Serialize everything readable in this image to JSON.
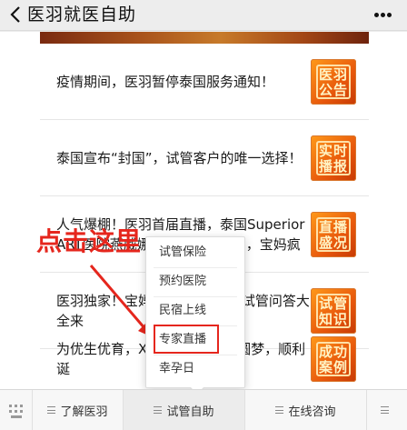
{
  "header": {
    "title": "医羽就医自助"
  },
  "articles": [
    {
      "title": "疫情期间，医羽暂停泰国服务通知！",
      "thumb": "医羽公告"
    },
    {
      "title": "泰国宣布“封国”，试管客户的唯一选择！",
      "thumb": "实时播报"
    },
    {
      "title": "人气爆棚！医羽首届直播，泰国Superior ART医院燕威娜医生降临直播间，宝妈疯狂...",
      "thumb": "直播盛况"
    },
    {
      "title": "医羽独家！宝妈 娜直播的24个试管问答大全来",
      "thumb": "试管知识"
    },
    {
      "title": "为优生优育，X 二移，32岁终圆梦，顺利诞",
      "thumb": "成功案例"
    }
  ],
  "popup": {
    "items": [
      "试管保险",
      "预约医院",
      "民宿上线",
      "专家直播",
      "幸孕日"
    ]
  },
  "annotation": {
    "text": "点击这里"
  },
  "tabs": [
    {
      "label": "了解医羽"
    },
    {
      "label": "试管自助"
    },
    {
      "label": "在线咨询"
    }
  ],
  "colors": {
    "accent_red": "#e5261d",
    "thumb_orange": "#e8580c"
  }
}
